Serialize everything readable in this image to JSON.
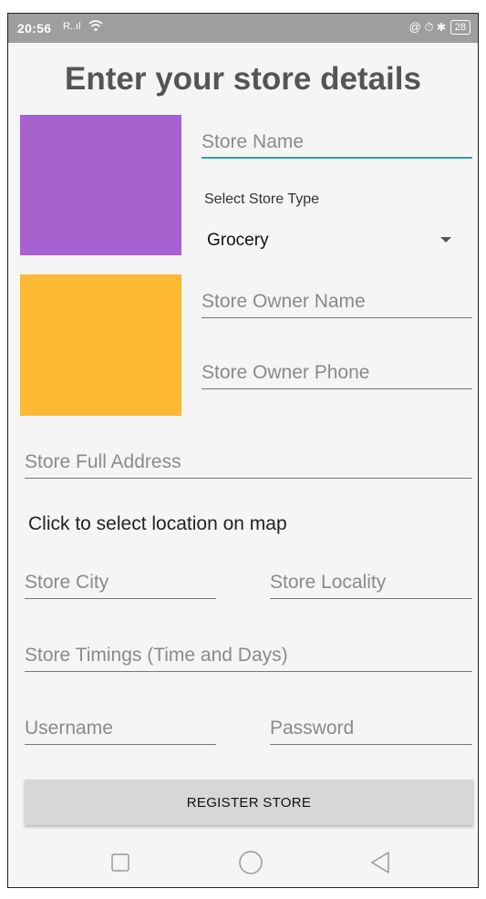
{
  "status_bar": {
    "time": "20:56",
    "signal": "R..ıl",
    "wifi_icon": "wifi-icon",
    "right_icons": "@ ⏱ ✱",
    "battery": "28"
  },
  "title": "Enter your store details",
  "swatches": {
    "top_color": "#a862cf",
    "bottom_color": "#fdb834"
  },
  "store_name": {
    "placeholder": "Store Name"
  },
  "store_type": {
    "label": "Select Store Type",
    "selected": "Grocery"
  },
  "owner_name": {
    "placeholder": "Store Owner Name"
  },
  "owner_phone": {
    "placeholder": "Store Owner Phone"
  },
  "full_address": {
    "placeholder": "Store Full Address"
  },
  "map_prompt": "Click to select location on map",
  "city": {
    "placeholder": "Store City"
  },
  "locality": {
    "placeholder": "Store Locality"
  },
  "timings": {
    "placeholder": "Store Timings (Time and Days)"
  },
  "username": {
    "placeholder": "Username"
  },
  "password": {
    "placeholder": "Password"
  },
  "register_button": "REGISTER STORE",
  "nav": {
    "recents": "recents-icon",
    "home": "home-icon",
    "back": "back-icon"
  },
  "accent_color": "#26a69a"
}
